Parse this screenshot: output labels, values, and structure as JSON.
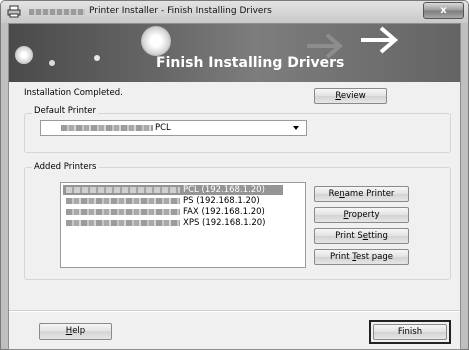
{
  "window": {
    "title": "Printer Installer - Finish Installing Drivers",
    "close_label": "x"
  },
  "banner": {
    "title": "Finish Installing Drivers"
  },
  "status": {
    "text": "Installation Completed."
  },
  "review_button": {
    "pre": "",
    "key": "R",
    "post": "eview"
  },
  "default_printer": {
    "group_label": "Default Printer",
    "selected_suffix": "PCL"
  },
  "added_printers": {
    "group_label": "Added Printers",
    "items": [
      {
        "text": "PCL (192.168.1.20)",
        "selected": true
      },
      {
        "text": "PS (192.168.1.20)",
        "selected": false
      },
      {
        "text": "FAX (192.168.1.20)",
        "selected": false
      },
      {
        "text": "XPS (192.168.1.20)",
        "selected": false
      }
    ]
  },
  "buttons": {
    "rename": {
      "pre": "Re",
      "key": "n",
      "post": "ame Printer"
    },
    "property": {
      "pre": "",
      "key": "P",
      "post": "roperty"
    },
    "print_setting": {
      "pre": "Print S",
      "key": "e",
      "post": "tting"
    },
    "print_test": {
      "pre": "Print ",
      "key": "T",
      "post": "est page"
    },
    "help": {
      "pre": "",
      "key": "H",
      "post": "elp"
    },
    "finish": {
      "label": "Finish"
    }
  }
}
